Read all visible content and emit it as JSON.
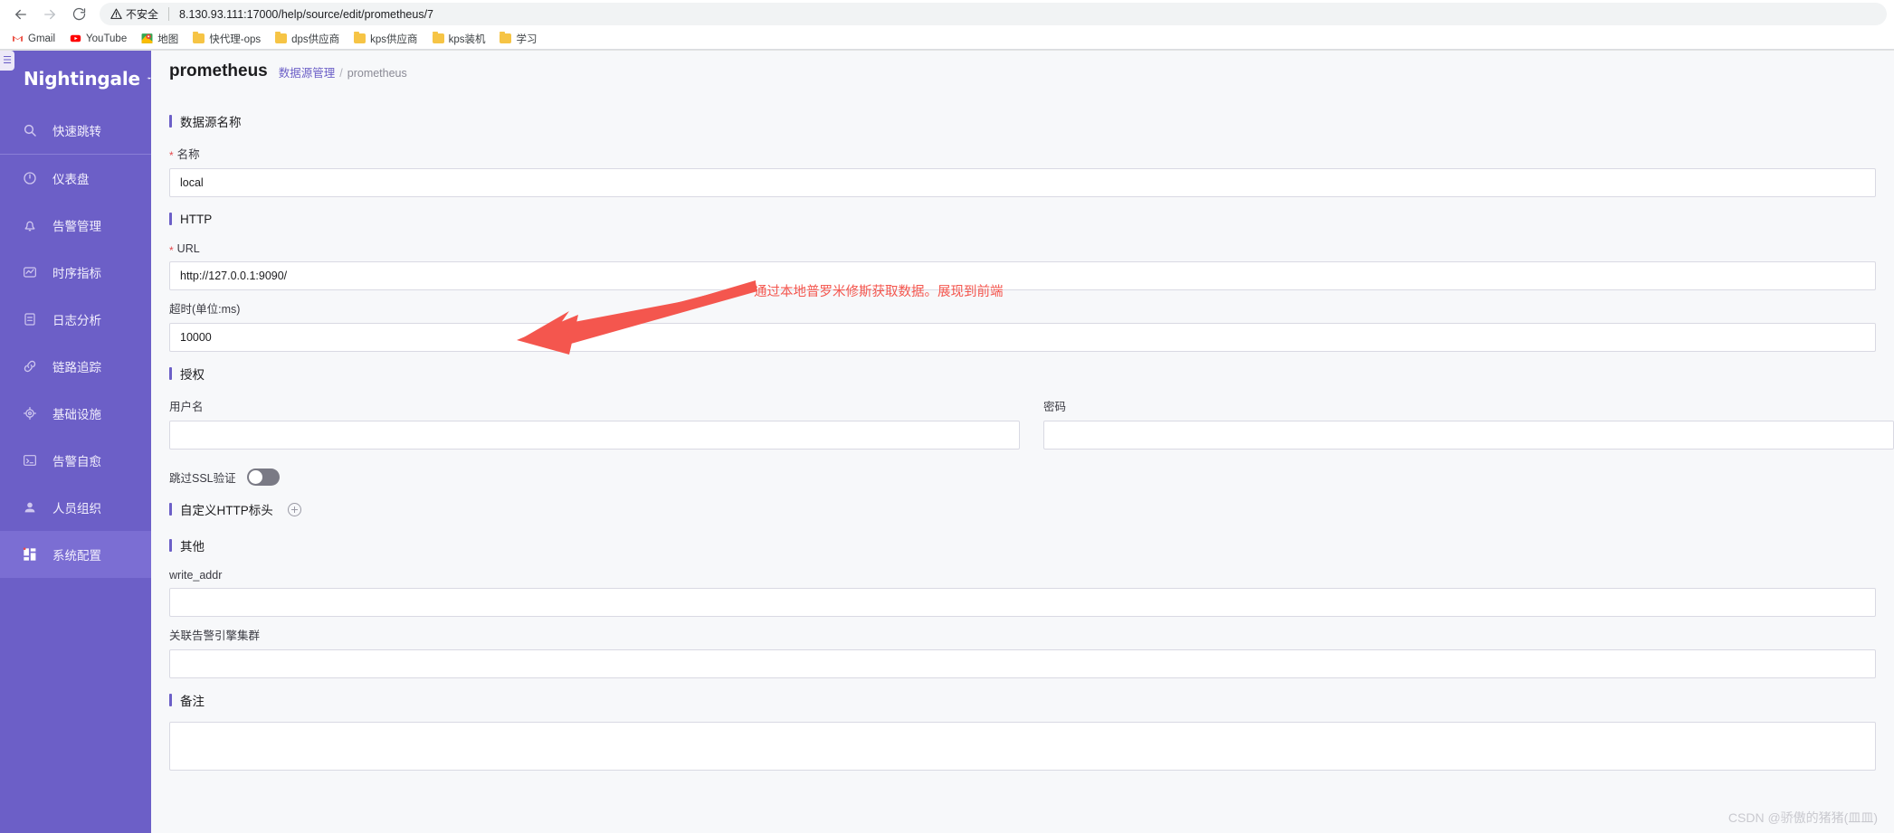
{
  "browser": {
    "back_icon": "back-arrow-icon",
    "forward_icon": "forward-arrow-icon",
    "reload_icon": "reload-icon",
    "security_label": "不安全",
    "url": "8.130.93.111:17000/help/source/edit/prometheus/7",
    "bookmarks": [
      {
        "label": "Gmail",
        "icon": "gmail-icon"
      },
      {
        "label": "YouTube",
        "icon": "youtube-icon"
      },
      {
        "label": "地图",
        "icon": "google-maps-icon"
      },
      {
        "label": "快代理-ops",
        "icon": "folder-icon"
      },
      {
        "label": "dps供应商",
        "icon": "folder-icon"
      },
      {
        "label": "kps供应商",
        "icon": "folder-icon"
      },
      {
        "label": "kps装机",
        "icon": "folder-icon"
      },
      {
        "label": "学习",
        "icon": "folder-icon"
      }
    ]
  },
  "sidebar": {
    "brand": "Nightingale",
    "brand_icon": "nightingale-bird-icon",
    "collapse_icon": "collapse-menu-icon",
    "accent_color": "#6c5fc7",
    "items": [
      {
        "label": "快速跳转",
        "icon": "search-icon",
        "active": false
      },
      {
        "label": "仪表盘",
        "icon": "dashboard-icon",
        "active": false
      },
      {
        "label": "告警管理",
        "icon": "bell-icon",
        "active": false
      },
      {
        "label": "时序指标",
        "icon": "chart-line-icon",
        "active": false
      },
      {
        "label": "日志分析",
        "icon": "log-icon",
        "active": false
      },
      {
        "label": "链路追踪",
        "icon": "link-icon",
        "active": false
      },
      {
        "label": "基础设施",
        "icon": "target-icon",
        "active": false
      },
      {
        "label": "告警自愈",
        "icon": "terminal-icon",
        "active": false
      },
      {
        "label": "人员组织",
        "icon": "user-icon",
        "active": false
      },
      {
        "label": "系统配置",
        "icon": "grid-settings-icon",
        "active": true
      }
    ]
  },
  "header": {
    "title": "prometheus",
    "breadcrumb": {
      "parent": "数据源管理",
      "separator": "/",
      "current": "prometheus"
    }
  },
  "form": {
    "sections": {
      "datasource_name": "数据源名称",
      "http": "HTTP",
      "auth": "授权",
      "custom_headers": "自定义HTTP标头",
      "other": "其他",
      "remark": "备注"
    },
    "fields": {
      "name": {
        "label": "名称",
        "required": true,
        "value": "local",
        "placeholder": ""
      },
      "url": {
        "label": "URL",
        "required": true,
        "value": "http://127.0.0.1:9090/",
        "placeholder": ""
      },
      "timeout": {
        "label": "超时(单位:ms)",
        "required": false,
        "value": "10000",
        "placeholder": ""
      },
      "username": {
        "label": "用户名",
        "required": false,
        "value": "",
        "placeholder": ""
      },
      "password": {
        "label": "密码",
        "required": false,
        "value": "",
        "placeholder": ""
      },
      "skip_ssl": {
        "label": "跳过SSL验证",
        "on": false
      },
      "write_addr": {
        "label": "write_addr",
        "required": false,
        "value": "",
        "placeholder": ""
      },
      "alert_cluster": {
        "label": "关联告警引擎集群",
        "required": false,
        "value": "",
        "placeholder": ""
      }
    },
    "add_header_icon": "plus-circle-icon"
  },
  "annotation": {
    "text": "通过本地普罗米修斯获取数据。展现到前端",
    "color": "#f4564e",
    "arrow_icon": "arrow-pointer-icon"
  },
  "watermark": "CSDN @骄傲的猪猪(皿皿)"
}
